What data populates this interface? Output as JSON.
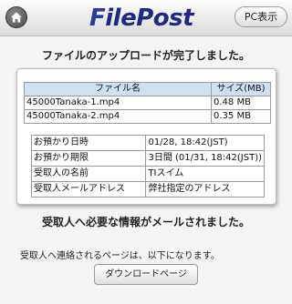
{
  "header": {
    "logo_first": "F",
    "logo_rest": "ilePost",
    "pc_button_label": "PC表示"
  },
  "upload_complete_message": "ファイルのアップロードが完了しました。",
  "files_table": {
    "headers": [
      "ファイル名",
      "サイズ(MB)"
    ],
    "rows": [
      {
        "name": "45000Tanaka-1.mp4",
        "size": "0.48 MB"
      },
      {
        "name": "45000Tanaka-2.mp4",
        "size": "0.35 MB"
      }
    ]
  },
  "info_table": {
    "rows": [
      {
        "label": "お預かり日時",
        "value": "01/28, 18:42(JST)"
      },
      {
        "label": "お預かり期限",
        "value": "3日間 (01/31, 18:42(JST))"
      },
      {
        "label": "受取人の名前",
        "value": "TIスイム"
      },
      {
        "label": "受取人メールアドレス",
        "value": "弊社指定のアドレス"
      }
    ]
  },
  "email_sent_message": "受取人へ必要な情報がメールされました。",
  "page_note": "受取人へ連絡されるページは、以下になります。",
  "download_button_label": "ダウンロードページ",
  "colors": {
    "logo": "#1c2a86",
    "table_header_bg": "#cfe0f2"
  },
  "icons": {
    "home": "home-icon"
  }
}
